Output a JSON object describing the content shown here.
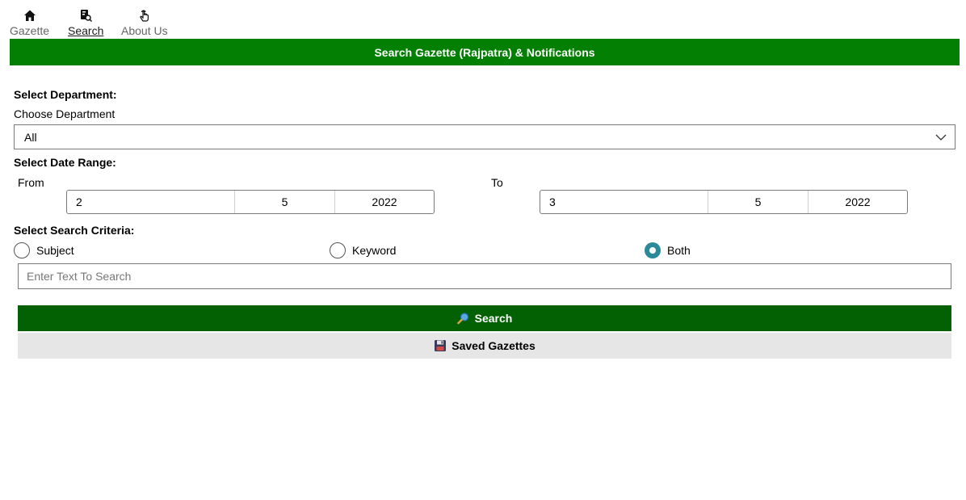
{
  "nav": {
    "items": [
      {
        "label": "Gazette",
        "icon": "home-icon"
      },
      {
        "label": "Search",
        "icon": "search-document-icon"
      },
      {
        "label": "About Us",
        "icon": "touch-hand-icon"
      }
    ],
    "active": "Search"
  },
  "banner": {
    "title": "Search Gazette (Rajpatra) & Notifications"
  },
  "department": {
    "section_label": "Select Department:",
    "choose_label": "Choose Department",
    "selected": "All"
  },
  "date_range": {
    "section_label": "Select Date Range:",
    "from_label": "From",
    "to_label": "To",
    "from": {
      "day": "2",
      "month": "5",
      "year": "2022"
    },
    "to": {
      "day": "3",
      "month": "5",
      "year": "2022"
    }
  },
  "criteria": {
    "section_label": "Select Search Criteria:",
    "options": [
      "Subject",
      "Keyword",
      "Both"
    ],
    "selected": "Both"
  },
  "search_input": {
    "placeholder": "Enter Text To Search",
    "value": ""
  },
  "buttons": {
    "search_label": "Search",
    "saved_label": "Saved Gazettes"
  },
  "colors": {
    "banner": "#037f03",
    "search_button": "#036103",
    "saved_button": "#e6e6e6",
    "radio_checked": "#2b8a99"
  }
}
